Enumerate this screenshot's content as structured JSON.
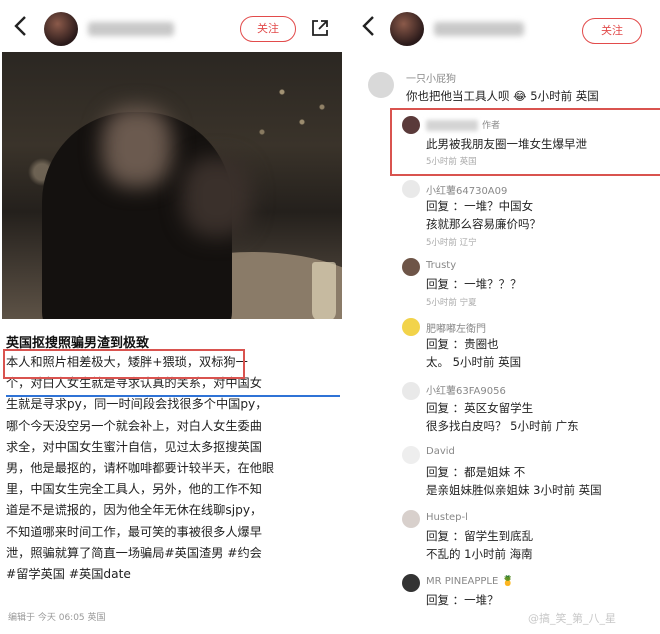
{
  "left": {
    "follow_label": "关注",
    "post_title": "英国抠搜照骗男渣到极致",
    "post_lines": [
      "本人和照片相差极大，矮胖+猥琐，双标狗一",
      "个，对白人女生就是寻求认真的关系，对中国女",
      "生就是寻求py，同一时间段会找很多个中国py，",
      "哪个今天没空另一个就会补上，对白人女生委曲",
      "求全，对中国女生蜜汁自信，见过太多抠搜英国",
      "男，他是最抠的，请杯咖啡都要计较半天，在他眼",
      "里，中国女生完全工具人，另外，他的工作不知",
      "道是不是谎报的，因为他全年无休在线聊sjpy，",
      "不知道哪来时间工作，最可笑的事被很多人爆早",
      "泄，照骗就算了简直一场骗局#英国渣男 #约会",
      "#留学英国 #英国date"
    ],
    "footer": "编辑于 今天 06:05 英国"
  },
  "right": {
    "follow_label": "关注",
    "watermark": "@搞_笑_第_八_星",
    "comments": [
      {
        "name": "一只小屁狗",
        "text": [
          "你也把他当工具人呗 😂 5小时前 英国"
        ],
        "meta": ""
      },
      {
        "name": "作者",
        "text": [
          "此男被我朋友圈一堆女生爆早泄"
        ],
        "meta": "5小时前 英国"
      },
      {
        "name": "小红薯64730A09",
        "text": [
          "回复              ：一堆？中国女",
          "孩就那么容易廉价吗？"
        ],
        "meta": "5小时前 辽宁"
      },
      {
        "name": "Trusty",
        "text": [
          "回复                ：一堆？？？"
        ],
        "meta": "5小时前 宁夏"
      },
      {
        "name": "肥嘟嘟左衛門",
        "text": [
          "回复              ：贵圈也",
          "太。             5小时前 英国"
        ],
        "meta": ""
      },
      {
        "name": "小红薯63FA9056",
        "text": [
          "回复              ：英区女留学生",
          "很多找白皮吗？ 5小时前 广东"
        ],
        "meta": ""
      },
      {
        "name": "David",
        "text": [
          "回复              ：都是姐妹 不",
          "是亲姐妹胜似亲姐妹 3小时前 英国"
        ],
        "meta": ""
      },
      {
        "name": "Hustep-l",
        "text": [
          "回复              ：留学生到底乱",
          "不乱的 1小时前 海南"
        ],
        "meta": ""
      },
      {
        "name": "MR PINEAPPLE 🍍",
        "text": [
          "回复                ：一堆？"
        ],
        "meta": ""
      }
    ]
  }
}
